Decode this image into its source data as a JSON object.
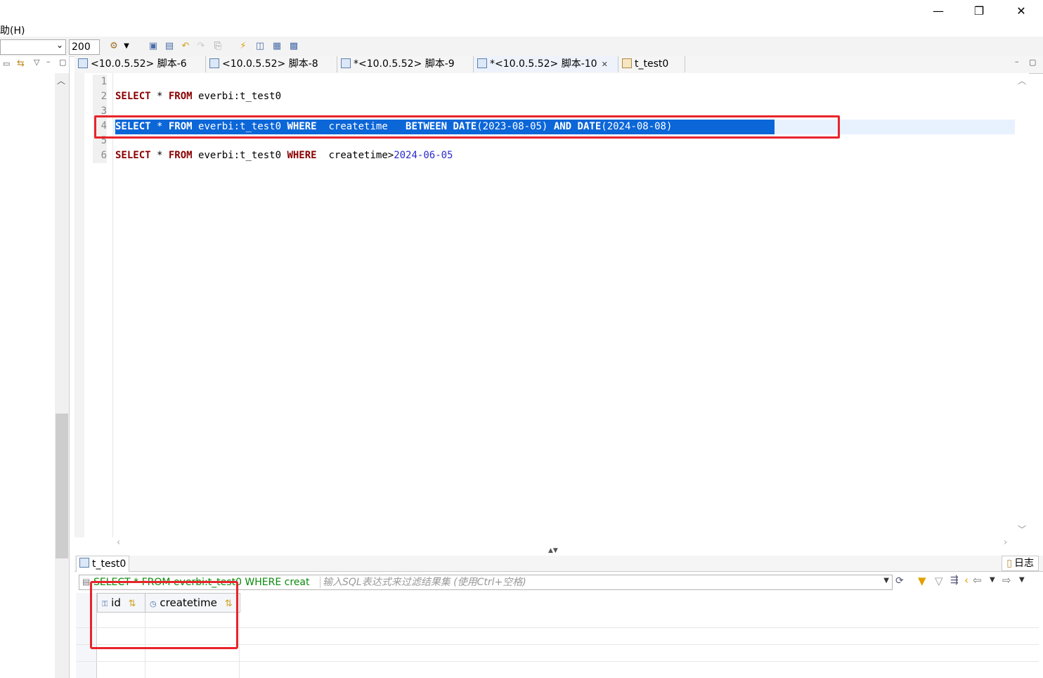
{
  "window": {
    "minimize_glyph": "—",
    "restore_glyph": "❐",
    "close_glyph": "✕"
  },
  "menubar": {
    "help_label": "助(H)"
  },
  "toolbar": {
    "limit_value": "200",
    "icons": [
      "run-menu-icon",
      "save-icon",
      "save-as-icon",
      "commit-icon",
      "rollback-icon",
      "paste-icon",
      "execute-icon",
      "explain-icon",
      "export-icon",
      "grid-icon"
    ]
  },
  "tabs": [
    {
      "label": "<10.0.5.52> 脚本-6",
      "active": false
    },
    {
      "label": "<10.0.5.52> 脚本-8",
      "active": false
    },
    {
      "label": "*<10.0.5.52> 脚本-9",
      "active": false
    },
    {
      "label": "*<10.0.5.52> 脚本-10",
      "active": true,
      "close_glyph": "✕"
    },
    {
      "label": "t_test0",
      "active": false
    }
  ],
  "editor": {
    "line_numbers": [
      "1",
      "2",
      "3",
      "4",
      "5",
      "6"
    ],
    "line2": {
      "kw1": "SELECT",
      "star": " * ",
      "kw2": "FROM",
      "rest": " everbi:t_test0"
    },
    "line4": {
      "kw1": "SELECT",
      "star": " * ",
      "kw2": "FROM",
      "tbl": " everbi:t_test0 ",
      "kw3": "WHERE",
      "col": "  createtime   ",
      "kw4": "BETWEEN",
      "sp1": " ",
      "kw5": "DATE",
      "arg1": "(2023-08-05)",
      "sp2": " ",
      "kw6": "AND",
      "sp3": " ",
      "kw7": "DATE",
      "arg2": "(2024-08-08)"
    },
    "line6": {
      "kw1": "SELECT",
      "star": " * ",
      "kw2": "FROM",
      "tbl": " everbi:t_test0 ",
      "kw3": "WHERE",
      "col": "  createtime>",
      "num": "2024-06-05"
    }
  },
  "results": {
    "tab_label": "t_test0",
    "log_label": "日志",
    "filter_query": "SELECT * FROM everbi:t_test0 WHERE creat",
    "filter_placeholder": "输入SQL表达式来过滤结果集 (使用Ctrl+空格)",
    "columns": [
      "id",
      "createtime"
    ]
  },
  "colors": {
    "accent_red": "#e8242b",
    "selection": "#0b66d8",
    "keyword": "#8b0000",
    "number": "#2a2ad0"
  }
}
